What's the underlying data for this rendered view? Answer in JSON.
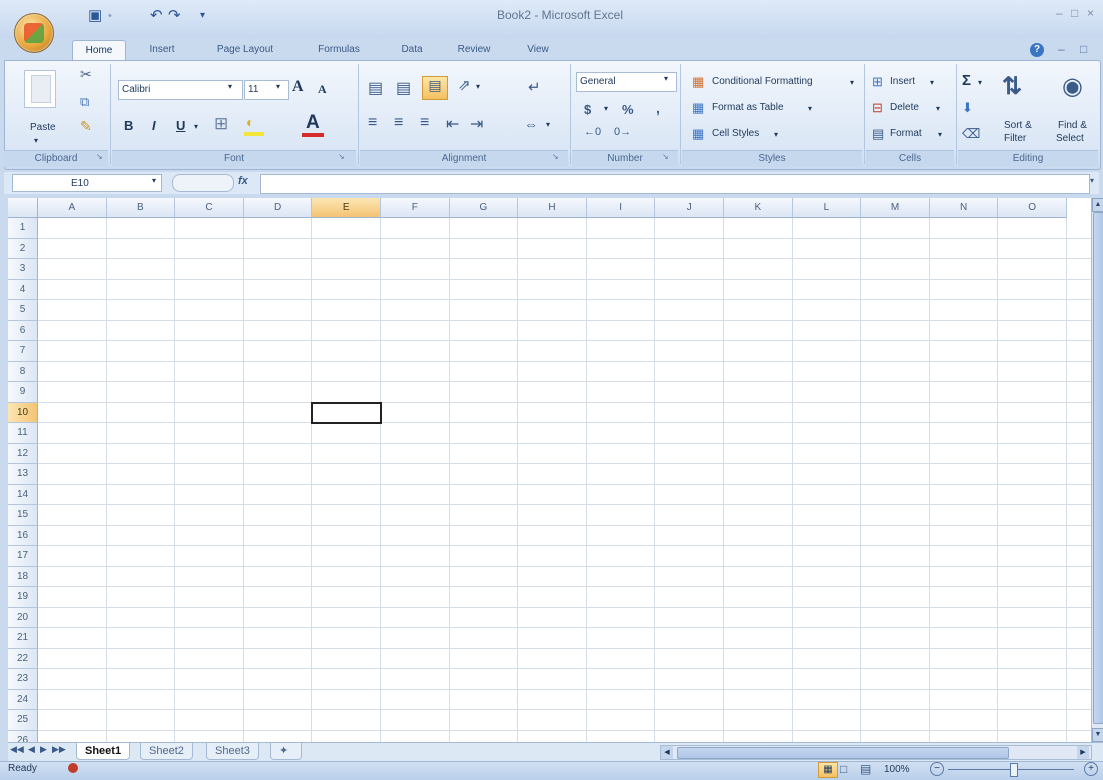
{
  "window": {
    "title": "Book2 - Microsoft Excel"
  },
  "tabs": [
    "Home",
    "Insert",
    "Page Layout",
    "Formulas",
    "Data",
    "Review",
    "View"
  ],
  "active_tab": "Home",
  "ribbon": {
    "clipboard": {
      "paste": "Paste",
      "label": "Clipboard"
    },
    "font": {
      "name": "Calibri",
      "size": "11",
      "grow": "A",
      "shrink": "A",
      "bold": "B",
      "italic": "I",
      "underline": "U",
      "label": "Font"
    },
    "alignment": {
      "label": "Alignment"
    },
    "number": {
      "format": "General",
      "currency": "$",
      "percent": "%",
      "comma": ",",
      "label": "Number"
    },
    "styles": {
      "conditional": "Conditional Formatting",
      "table": "Format as Table",
      "cell_styles": "Cell Styles",
      "label": "Styles"
    },
    "cells": {
      "insert": "Insert",
      "delete": "Delete",
      "format": "Format",
      "label": "Cells"
    },
    "editing": {
      "sigma": "Σ",
      "sort_top": "Sort &",
      "sort_bottom": "Filter",
      "find_top": "Find &",
      "find_bottom": "Select",
      "label": "Editing"
    }
  },
  "formula_bar": {
    "name_box": "E10",
    "fx": "fx",
    "value": ""
  },
  "columns": [
    "A",
    "B",
    "C",
    "D",
    "E",
    "F",
    "G",
    "H",
    "I",
    "J",
    "K",
    "L",
    "M",
    "N",
    "O"
  ],
  "rows": [
    "1",
    "2",
    "3",
    "4",
    "5",
    "6",
    "7",
    "8",
    "9",
    "10",
    "11",
    "12",
    "13",
    "14",
    "15",
    "16",
    "17",
    "18",
    "19",
    "20",
    "21",
    "22",
    "23",
    "24",
    "25",
    "26"
  ],
  "selected": {
    "column": "E",
    "row": "10"
  },
  "sheets": [
    "Sheet1",
    "Sheet2",
    "Sheet3"
  ],
  "active_sheet": "Sheet1",
  "status": {
    "text": "Ready",
    "zoom": "100%"
  },
  "colors": {
    "accent": "#f4c474",
    "ribbon": "#dbe7f6",
    "frame": "#c9d9ee"
  }
}
